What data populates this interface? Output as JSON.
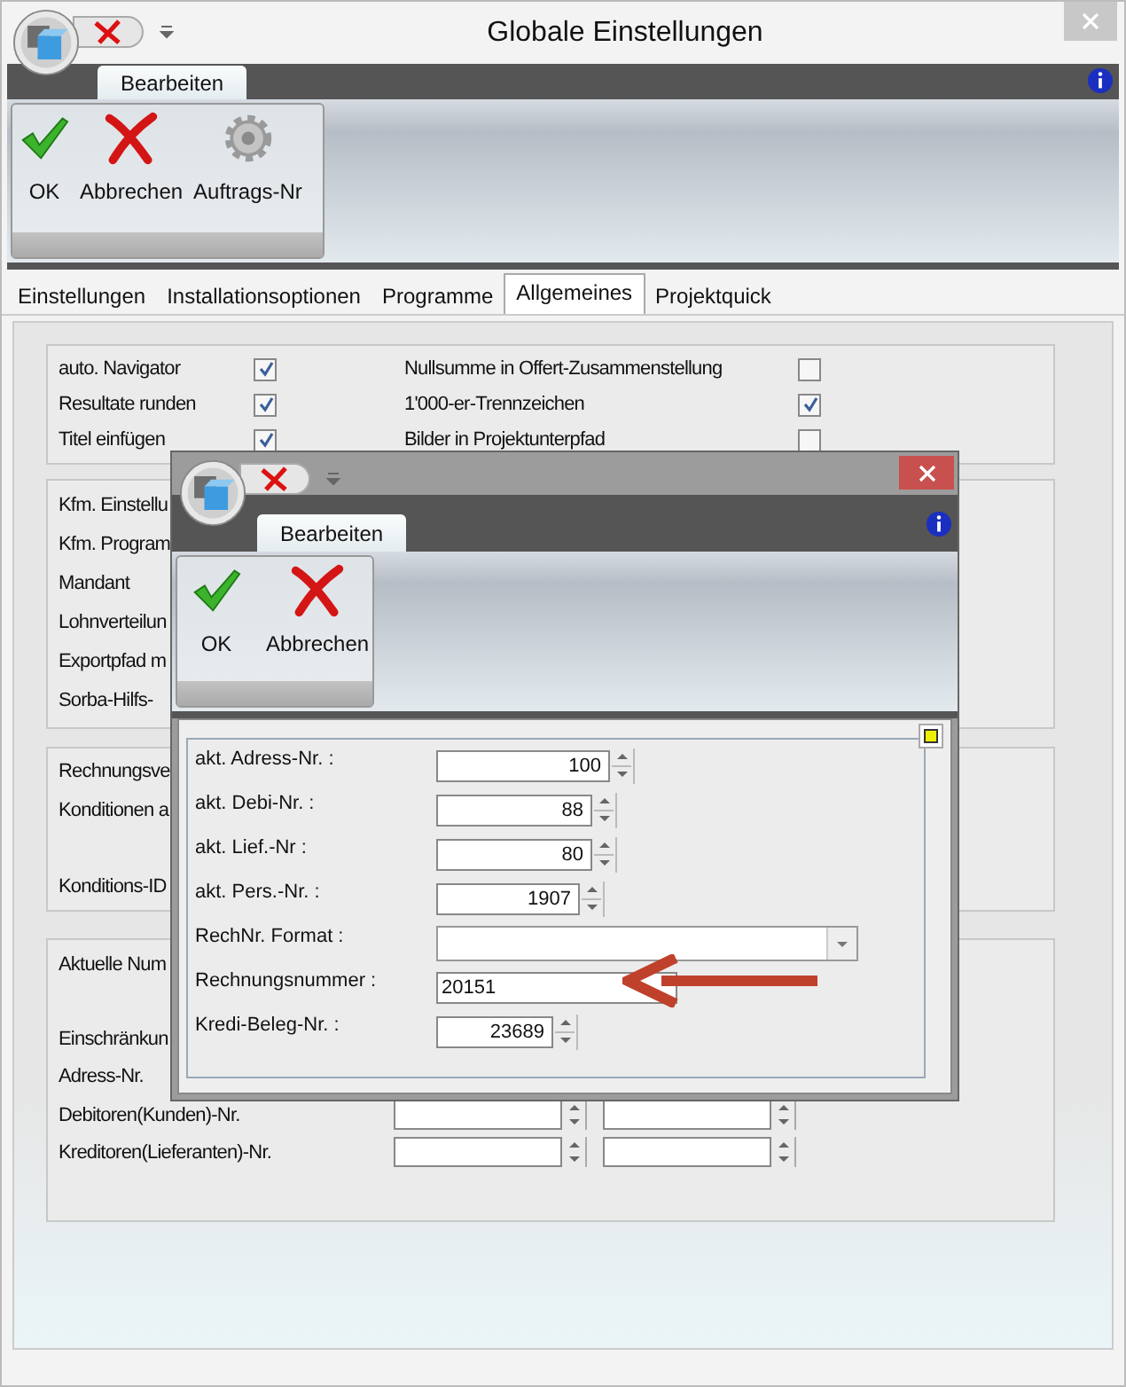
{
  "window": {
    "title": "Globale Einstellungen"
  },
  "ribbon": {
    "tabs": [
      {
        "label": "Bearbeiten",
        "selected": true
      }
    ],
    "buttons": [
      {
        "label": "OK",
        "kind": "ok"
      },
      {
        "label": "Abbrechen",
        "kind": "cancel"
      },
      {
        "label": "Auftrags-Nr",
        "kind": "gear"
      }
    ]
  },
  "tabs": [
    {
      "label": "Einstellungen",
      "selected": false
    },
    {
      "label": "Installationsoptionen",
      "selected": false
    },
    {
      "label": "Programme",
      "selected": false
    },
    {
      "label": "Allgemeines",
      "selected": true
    },
    {
      "label": "Projektquick",
      "selected": false
    }
  ],
  "options": [
    {
      "label": "auto. Navigator",
      "checked": true
    },
    {
      "label": "Nullsumme in Offert-Zusammenstellung",
      "checked": false
    },
    {
      "label": "Resultate runden",
      "checked": true
    },
    {
      "label": "1'000-er-Trennzeichen",
      "checked": true
    },
    {
      "label": "Titel einfügen",
      "checked": true
    },
    {
      "label": "Bilder in Projektunterpfad",
      "checked": false
    }
  ],
  "groups": [
    {
      "rows": [
        {
          "label": "Kfm. Einstellu"
        },
        {
          "label": "Kfm. Program"
        },
        {
          "label": "Mandant"
        },
        {
          "label": "Lohnverteilun"
        },
        {
          "label": "Exportpfad m"
        },
        {
          "label": "Sorba-Hilfs-"
        }
      ]
    },
    {
      "rows": [
        {
          "label": "Rechnungsve"
        },
        {
          "label": "Konditionen a"
        },
        {
          "label": "Konditions-ID"
        }
      ]
    },
    {
      "rows": [
        {
          "label": "Aktuelle Num"
        },
        {
          "label": "Einschränkun"
        },
        {
          "label": "Adress-Nr."
        },
        {
          "label": "Debitoren(Kunden)-Nr.",
          "kind": "spinfields"
        },
        {
          "label": "Kreditoren(Lieferanten)-Nr.",
          "kind": "spinfields"
        }
      ]
    }
  ],
  "dialog": {
    "ribbon": {
      "tabs": [
        {
          "label": "Bearbeiten",
          "selected": true
        }
      ],
      "buttons": [
        {
          "label": "OK",
          "kind": "ok"
        },
        {
          "label": "Abbrechen",
          "kind": "cancel"
        }
      ]
    },
    "fields": [
      {
        "label": "akt. Adress-Nr. :",
        "kind": "spin",
        "value": "100"
      },
      {
        "label": "akt. Debi-Nr. :",
        "kind": "spin",
        "value": "88"
      },
      {
        "label": "akt. Lief.-Nr :",
        "kind": "spin",
        "value": "80"
      },
      {
        "label": "akt. Pers.-Nr. :",
        "kind": "spin",
        "value": "1907"
      },
      {
        "label": "RechNr. Format :",
        "kind": "combo"
      },
      {
        "label": "Rechnungsnummer :",
        "kind": "text",
        "value": "20151"
      },
      {
        "label": "Kredi-Beleg-Nr. :",
        "kind": "spin",
        "value": "23689"
      }
    ]
  }
}
